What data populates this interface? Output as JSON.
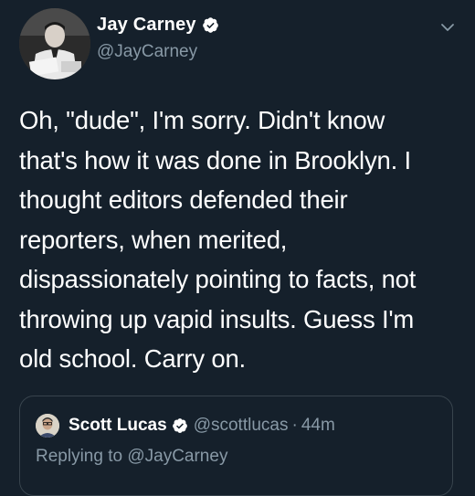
{
  "author": {
    "display_name": "Jay Carney",
    "handle": "@JayCarney",
    "verified": true
  },
  "tweet": {
    "text": "Oh, \"dude\", I'm sorry. Didn't know\nthat's how it was done in Brooklyn. I\nthought editors defended their\nreporters, when merited,\ndispassionately pointing to facts, not\nthrowing up vapid insults. Guess I'm\nold school. Carry on."
  },
  "quoted_tweet": {
    "display_name": "Scott Lucas",
    "handle": "@scottlucas",
    "separator": "·",
    "time": "44m",
    "verified": true,
    "replying_to": "Replying to @JayCarney"
  },
  "colors": {
    "background": "#15202b",
    "secondary_text": "#8899a6",
    "verified_badge": "#ffffff",
    "card_border": "#38444d"
  },
  "icons": {
    "verified": "verified-badge-icon",
    "menu": "chevron-down-icon"
  }
}
